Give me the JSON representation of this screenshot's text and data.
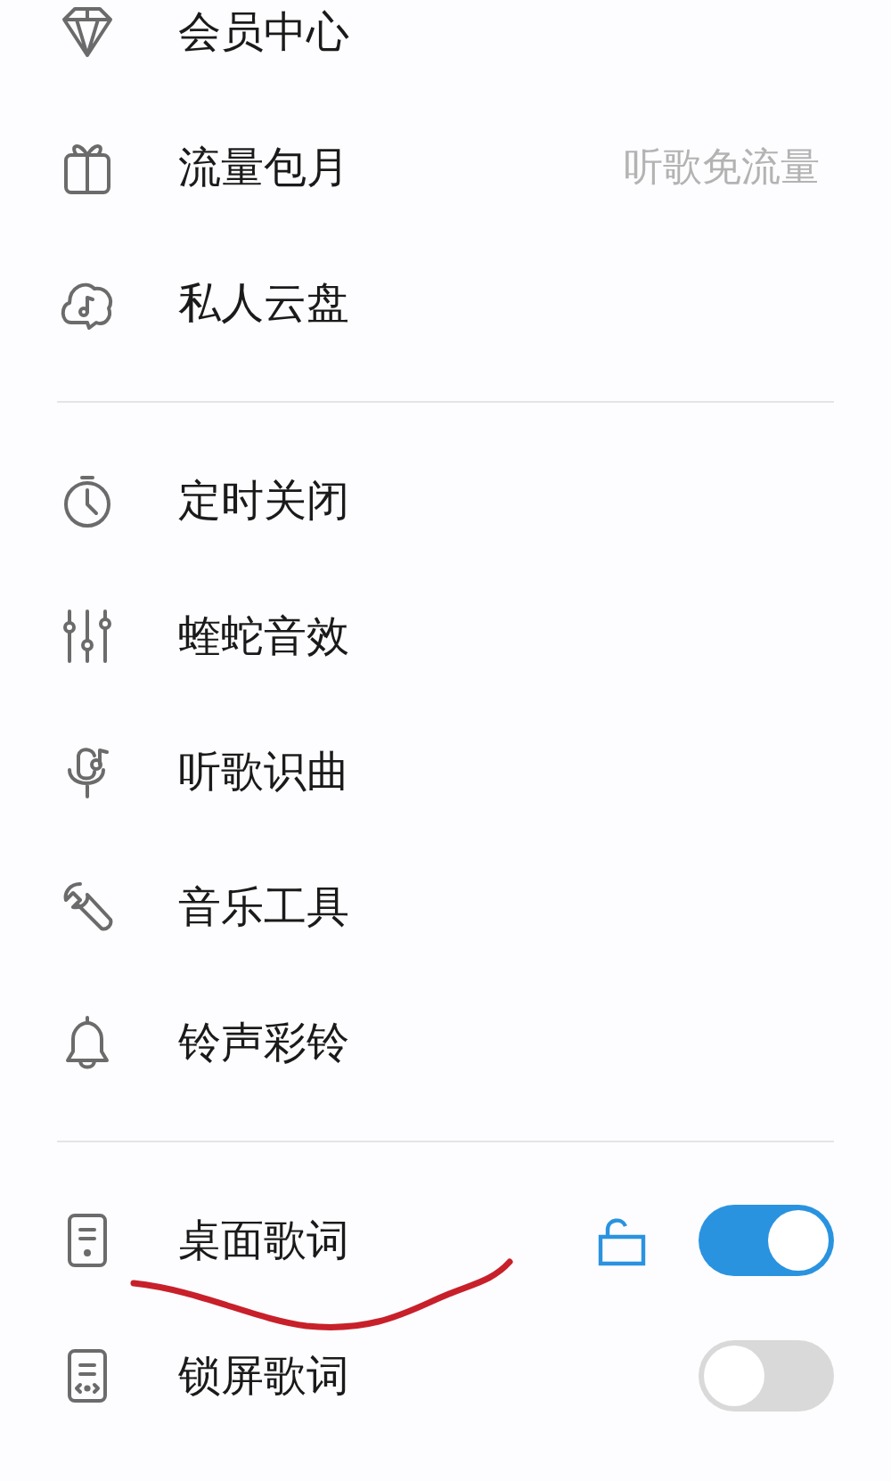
{
  "sections": [
    {
      "items": [
        {
          "kind": "link",
          "label": "会员中心"
        },
        {
          "kind": "link",
          "label": "流量包月",
          "detail": "听歌免流量"
        },
        {
          "kind": "link",
          "label": "私人云盘"
        }
      ]
    },
    {
      "items": [
        {
          "kind": "link",
          "label": "定时关闭"
        },
        {
          "kind": "link",
          "label": "蝰蛇音效"
        },
        {
          "kind": "link",
          "label": "听歌识曲"
        },
        {
          "kind": "link",
          "label": "音乐工具"
        },
        {
          "kind": "link",
          "label": "铃声彩铃"
        }
      ]
    },
    {
      "items": [
        {
          "kind": "toggle",
          "label": "桌面歌词",
          "lock": true,
          "on": true
        },
        {
          "kind": "toggle",
          "label": "锁屏歌词",
          "lock": false,
          "on": false
        }
      ]
    }
  ]
}
